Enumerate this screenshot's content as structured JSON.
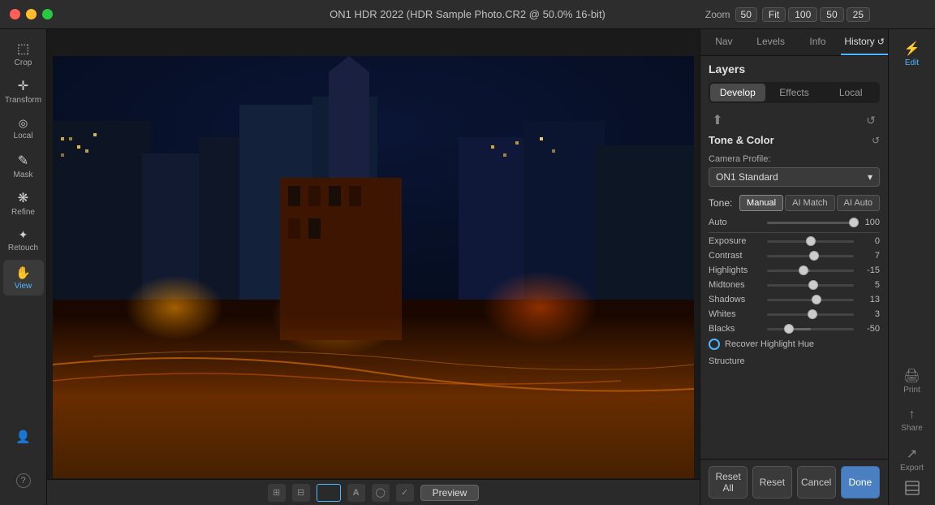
{
  "titlebar": {
    "title": "ON1 HDR 2022 (HDR Sample Photo.CR2 @ 50.0% 16-bit)",
    "zoom_label": "Zoom",
    "zoom_value": "50",
    "zoom_fit": "Fit",
    "zoom_100": "100",
    "zoom_50": "50",
    "zoom_25": "25"
  },
  "left_toolbar": {
    "tools": [
      {
        "id": "crop",
        "icon": "⬚",
        "label": "Crop"
      },
      {
        "id": "transform",
        "icon": "✛",
        "label": "Transform"
      },
      {
        "id": "local",
        "icon": "◎",
        "label": "Local"
      },
      {
        "id": "mask",
        "icon": "✎",
        "label": "Mask"
      },
      {
        "id": "refine",
        "icon": "❋",
        "label": "Refine"
      },
      {
        "id": "retouch",
        "icon": "✦",
        "label": "Retouch"
      },
      {
        "id": "view",
        "icon": "✋",
        "label": "View"
      }
    ],
    "bottom_tools": [
      {
        "id": "person",
        "icon": "👤"
      },
      {
        "id": "help",
        "icon": "?"
      }
    ]
  },
  "right_panel": {
    "nav_tabs": [
      "Nav",
      "Levels",
      "Info",
      "History"
    ],
    "active_nav_tab": "History",
    "layers_title": "Layers",
    "sub_tabs": [
      "Develop",
      "Effects",
      "Local"
    ],
    "active_sub_tab": "Develop",
    "section": {
      "title": "Tone & Color",
      "camera_profile_label": "Camera Profile:",
      "camera_profile_value": "ON1 Standard",
      "tone_label": "Tone:",
      "tone_buttons": [
        "Manual",
        "AI Match",
        "AI Auto"
      ],
      "active_tone_btn": "Manual",
      "auto_label": "Auto",
      "auto_value": "100",
      "sliders": [
        {
          "name": "Exposure",
          "value": 0,
          "position": 50,
          "fill_start": 50,
          "fill_end": 50
        },
        {
          "name": "Contrast",
          "value": 7,
          "position": 53,
          "fill_start": 50,
          "fill_end": 53
        },
        {
          "name": "Highlights",
          "value": -15,
          "position": 43,
          "fill_start": 43,
          "fill_end": 50
        },
        {
          "name": "Midtones",
          "value": 5,
          "position": 52,
          "fill_start": 50,
          "fill_end": 52
        },
        {
          "name": "Shadows",
          "value": 13,
          "position": 56,
          "fill_start": 50,
          "fill_end": 56
        },
        {
          "name": "Whites",
          "value": 3,
          "position": 51,
          "fill_start": 50,
          "fill_end": 51
        },
        {
          "name": "Blacks",
          "value": -50,
          "position": 25,
          "fill_start": 25,
          "fill_end": 50
        }
      ],
      "recover_highlight_hue": "Recover Highlight Hue",
      "structure_label": "Structure"
    }
  },
  "bottom_buttons": {
    "reset_all": "Reset All",
    "reset": "Reset",
    "cancel": "Cancel",
    "done": "Done"
  },
  "far_right": {
    "tools": [
      {
        "id": "edit",
        "icon": "⚡",
        "label": "Edit",
        "active": true
      },
      {
        "id": "print",
        "icon": "🖨",
        "label": "Print"
      },
      {
        "id": "share",
        "icon": "↑",
        "label": "Share"
      },
      {
        "id": "export",
        "icon": "↗",
        "label": "Export"
      }
    ]
  },
  "bottom_bar": {
    "preview_label": "Preview"
  },
  "colors": {
    "accent": "#4db8ff",
    "active_bg": "#4a7fc1"
  }
}
